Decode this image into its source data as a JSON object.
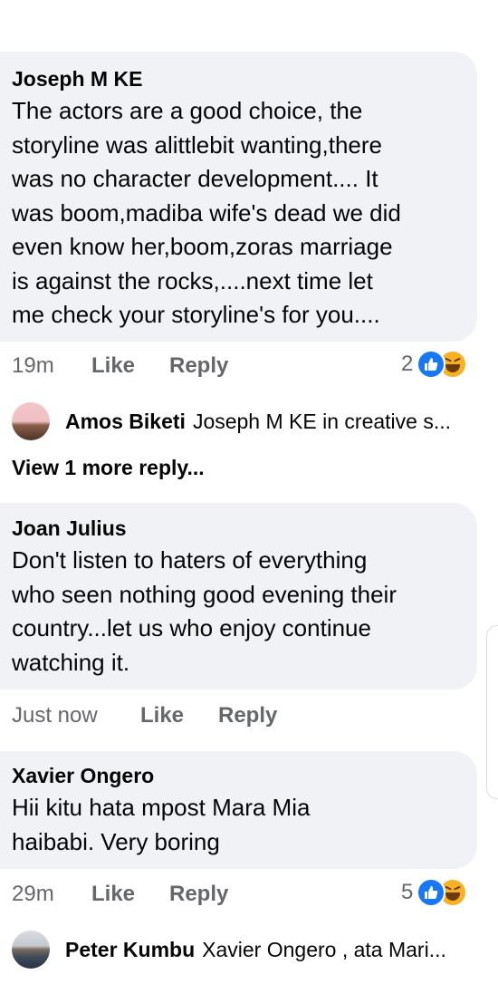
{
  "comments": [
    {
      "author": "Joseph M KE",
      "text": "The actors are a good choice, the\nstoryline was alittlebit wanting,there\nwas no character development.... It\nwas boom,madiba wife's dead we did\neven know her,boom,zoras marriage\nis against the rocks,....next time let\nme check your storyline's for you....",
      "time": "19m",
      "like": "Like",
      "reply": "Reply",
      "reaction_count": "2",
      "reactions": [
        "like-icon",
        "haha-icon"
      ]
    },
    {
      "author": "Joan  Julius",
      "text": "Don't listen to haters of everything\nwho seen nothing good evening their\ncountry...let us who enjoy continue\nwatching it.",
      "time": "Just now",
      "like": "Like",
      "reply": "Reply"
    },
    {
      "author": "Xavier Ongero",
      "text": "Hii kitu hata mpost  Mara Mia\nhaibabi. Very boring",
      "time": "29m",
      "like": "Like",
      "reply": "Reply",
      "reaction_count": "5",
      "reactions": [
        "like-icon",
        "haha-icon"
      ]
    }
  ],
  "replies": [
    {
      "author": "Amos Biketi",
      "snippet": "Joseph M KE in creative s..."
    },
    {
      "author": "Peter Kumbu",
      "snippet": "Xavier Ongero , ata Mari..."
    }
  ],
  "view_more": "View 1 more reply...",
  "colors": {
    "bubble": "#f0f2f5",
    "meta_text": "#65676b",
    "like_blue": "#1877f2",
    "haha_yellow": "#f7b125"
  }
}
